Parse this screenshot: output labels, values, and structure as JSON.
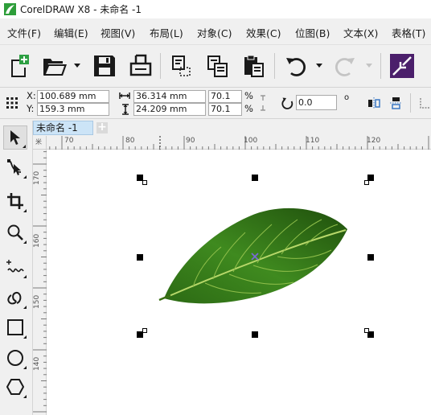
{
  "window": {
    "title": "CorelDRAW X8 - 未命名 -1"
  },
  "menu": [
    {
      "label": "文件(F)"
    },
    {
      "label": "编辑(E)"
    },
    {
      "label": "视图(V)"
    },
    {
      "label": "布局(L)"
    },
    {
      "label": "对象(C)"
    },
    {
      "label": "效果(C)"
    },
    {
      "label": "位图(B)"
    },
    {
      "label": "文本(X)"
    },
    {
      "label": "表格(T)"
    }
  ],
  "toolbar": {
    "icons": [
      "new-document-icon",
      "open-folder-icon",
      "save-icon",
      "print-icon",
      "cut-icon",
      "copy-icon",
      "paste-icon",
      "undo-icon",
      "redo-icon",
      "power-clip-icon"
    ]
  },
  "property_bar": {
    "x_label": "X:",
    "x_value": "100.689 mm",
    "y_label": "Y:",
    "y_value": "159.3 mm",
    "width_value": "36.314 mm",
    "height_value": "24.209 mm",
    "scale_x": "70.1",
    "scale_y": "70.1",
    "percent_symbol": "%",
    "rotation_value": "0.0",
    "degree_symbol": "o"
  },
  "document": {
    "tab_label": "未命名 -1",
    "new_tab_symbol": "+"
  },
  "rulers": {
    "unit_mark": "米",
    "horizontal_labels": [
      "70",
      "80",
      "90",
      "100",
      "110",
      "120"
    ],
    "vertical_labels": [
      "170",
      "160",
      "150",
      "140"
    ]
  },
  "colors": {
    "accent_tab": "#cce4f7",
    "powerclip_icon_bg": "#4b1f6b",
    "leaf_dark": "#1e4d0e",
    "leaf_light": "#7fb33a"
  }
}
